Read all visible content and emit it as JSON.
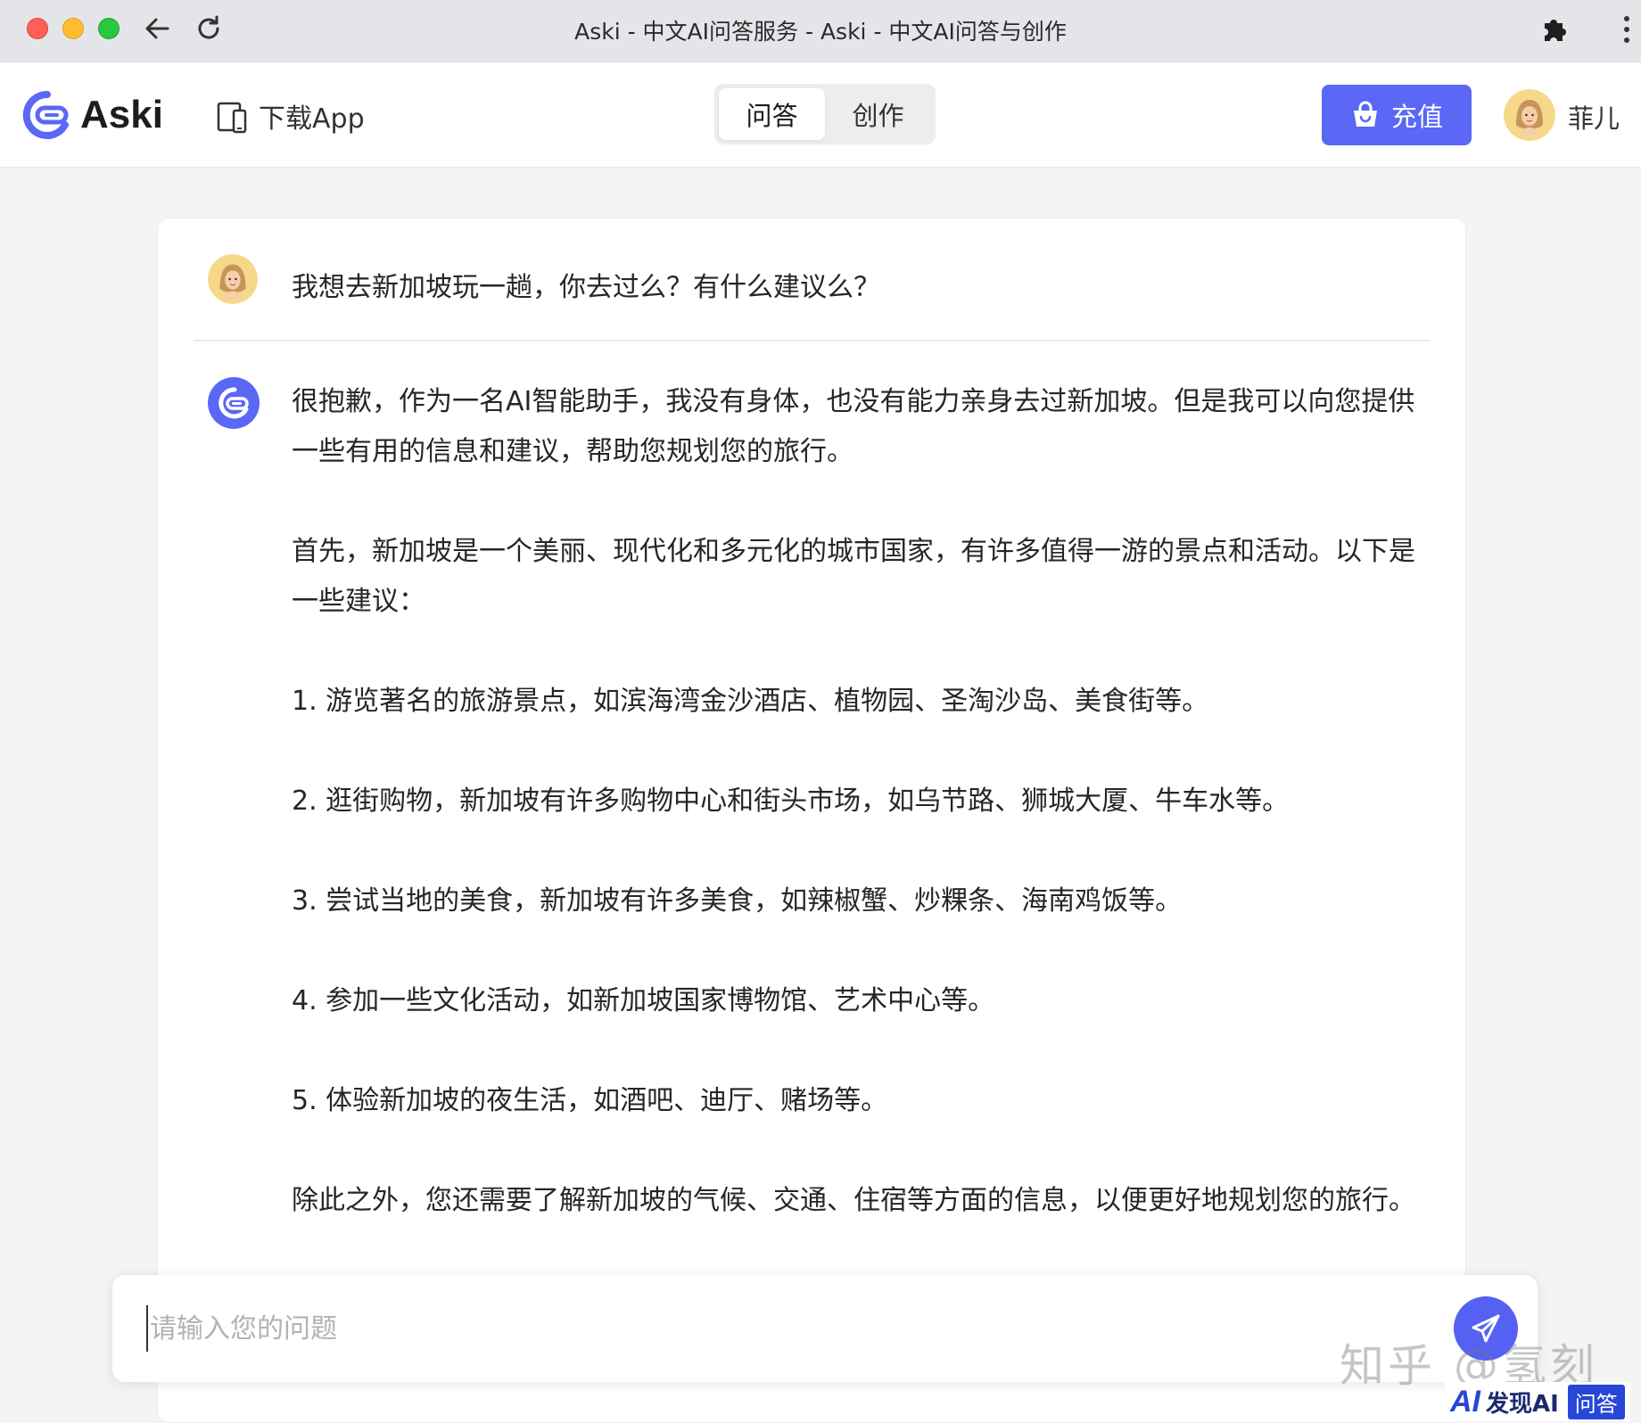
{
  "browser": {
    "window_title": "Aski - 中文AI问答服务 - Aski - 中文AI问答与创作"
  },
  "header": {
    "brand": "Aski",
    "download_app": "下载App",
    "mode_tabs": [
      {
        "label": "问答",
        "active": true
      },
      {
        "label": "创作",
        "active": false
      }
    ],
    "recharge_label": "充值",
    "user_name": "菲儿",
    "accent_color": "#5b67f5"
  },
  "chat": {
    "user_message": "我想去新加坡玩一趟，你去过么？有什么建议么？",
    "ai_paragraphs": [
      "很抱歉，作为一名AI智能助手，我没有身体，也没有能力亲身去过新加坡。但是我可以向您提供一些有用的信息和建议，帮助您规划您的旅行。",
      "首先，新加坡是一个美丽、现代化和多元化的城市国家，有许多值得一游的景点和活动。以下是一些建议：",
      "1. 游览著名的旅游景点，如滨海湾金沙酒店、植物园、圣淘沙岛、美食街等。",
      "2. 逛街购物，新加坡有许多购物中心和街头市场，如乌节路、狮城大厦、牛车水等。",
      "3. 尝试当地的美食，新加坡有许多美食，如辣椒蟹、炒粿条、海南鸡饭等。",
      "4. 参加一些文化活动，如新加坡国家博物馆、艺术中心等。",
      "5. 体验新加坡的夜生活，如酒吧、迪厅、赌场等。",
      "除此之外，您还需要了解新加坡的气候、交通、住宿等方面的信息，以便更好地规划您的旅行。"
    ]
  },
  "input": {
    "placeholder": "请输入您的问题",
    "value": ""
  },
  "watermark": {
    "zhihu": "知乎 @氢刻",
    "badge_ai": "AI",
    "badge_site": "发现AI",
    "badge_qa": "问答"
  }
}
